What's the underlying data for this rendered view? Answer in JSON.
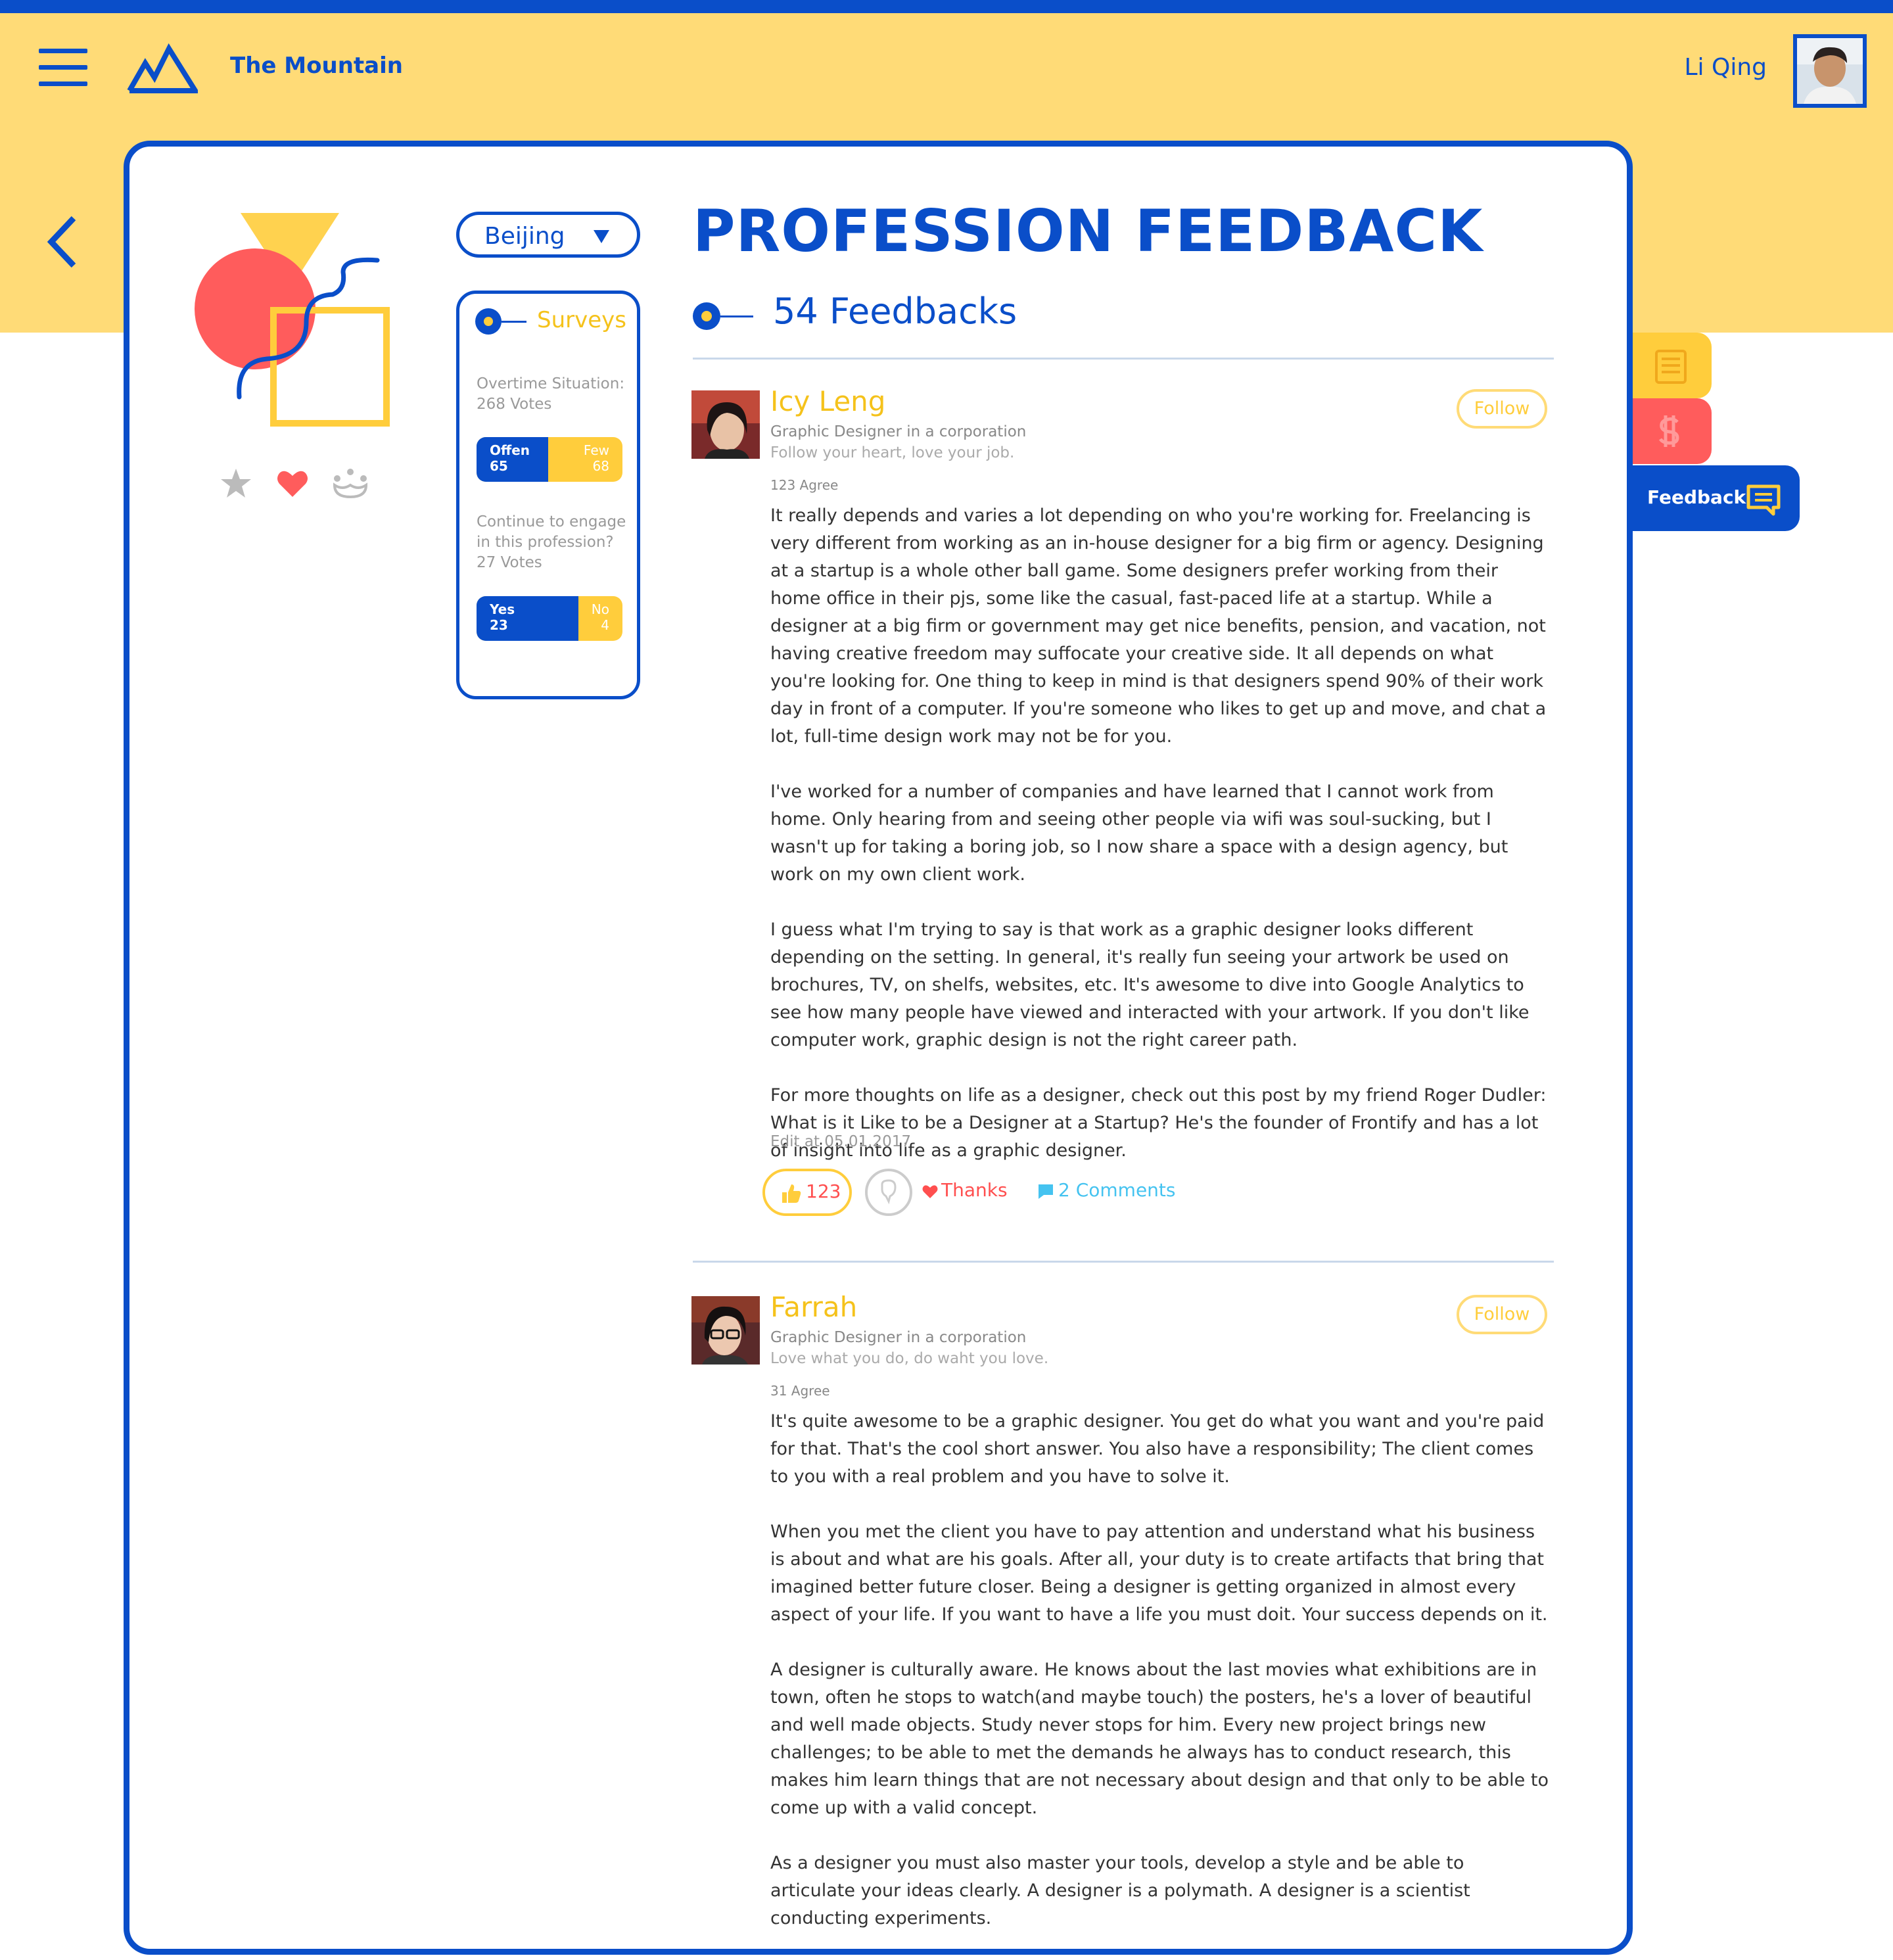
{
  "header": {
    "brand": "The Mountain",
    "username": "Li Qing"
  },
  "filter": {
    "city": "Beijing"
  },
  "surveys": {
    "title": "Surveys",
    "items": [
      {
        "question": "Overtime Situation:",
        "votes": "268 Votes",
        "left_label": "Offen",
        "left_value": "65",
        "right_label": "Few",
        "right_value": "68",
        "left_fraction": 0.49
      },
      {
        "question": "Continue to engage in this profession?",
        "votes": "27 Votes",
        "left_label": "Yes",
        "left_value": "23",
        "right_label": "No",
        "right_value": "4",
        "left_fraction": 0.7
      }
    ]
  },
  "main": {
    "title": "PROFESSION FEEDBACK",
    "count": "54 Feedbacks"
  },
  "side_tabs": {
    "feedback_label": "Feedback"
  },
  "colors": {
    "primary": "#0a4ec9",
    "yellow": "#ffcd3c",
    "red": "#ff5c5c",
    "header_bg": "#ffdb77",
    "link": "#45c3f0"
  },
  "posts": [
    {
      "name": "Icy Leng",
      "role": "Graphic Designer in a corporation",
      "motto": "Follow your heart, love your job.",
      "agree": "123 Agree",
      "follow": "Follow",
      "paragraphs": [
        "It really depends and varies a lot depending on who you're working for. Freelancing is very different from working as an in-house designer for a big firm or agency. Designing at a startup is a whole other ball game. Some designers prefer working from their home office in their pjs, some like the casual, fast-paced life at a startup. While a designer at a big firm or government may get nice benefits, pension, and vacation, not having creative freedom may suffocate your creative side. It all depends on what you're looking for. One thing to keep in mind is that designers spend 90% of their work day in front of a computer. If you're someone who likes to get up and move, and chat a lot, full-time design work may not be for you.",
        "I've worked for a number of companies and have learned that I cannot work from home. Only hearing from and seeing other people via wifi was soul-sucking, but I wasn't up for taking a boring job, so I now share a space with a design agency, but work on my own client work.",
        "I guess what I'm trying to say is that work as a graphic designer looks different depending on the setting. In general, it's really fun seeing your artwork be used on brochures, TV, on shelfs, websites, etc. It's awesome to dive into Google Analytics to see how many people have viewed and interacted with your artwork. If you don't like computer work, graphic design is not the right career path.",
        "For more thoughts on life as a designer, check out this post by my friend Roger Dudler: What is it Like to be a Designer at a Startup? He's the founder of Frontify and has a lot of insight into life as a graphic designer."
      ],
      "edited": "Edit at 05.01.2017",
      "likes": "123",
      "thanks": "Thanks",
      "comments": "2 Comments"
    },
    {
      "name": "Farrah",
      "role": "Graphic Designer in a corporation",
      "motto": "Love what you do, do waht you love.",
      "agree": "31 Agree",
      "follow": "Follow",
      "paragraphs": [
        "It's quite awesome to be a graphic designer. You get do what you want and you're paid for that. That's the cool short answer. You also have a responsibility; The client comes to you with a real problem and you have to solve it.",
        "When you met the client you have to pay attention and understand what his business is about and what are his goals. After all, your duty is to create artifacts that bring that imagined better future closer. Being a designer is getting organized in almost every aspect of your life. If you want to have a life you must doit. Your success depends on it.",
        "A designer is culturally aware. He knows about the last movies what exhibitions are in town, often he stops to watch(and maybe touch) the posters, he's a lover of beautiful and well made objects. Study never stops for him. Every new project brings new challenges; to be able to met the demands he always has to conduct research, this makes him learn things that are not necessary about design and that only to be able to come up with a valid concept.",
        "As a designer you must also master your tools, develop a style and be able to articulate your ideas clearly. A designer is a polymath. A designer is a scientist conducting experiments."
      ]
    }
  ]
}
